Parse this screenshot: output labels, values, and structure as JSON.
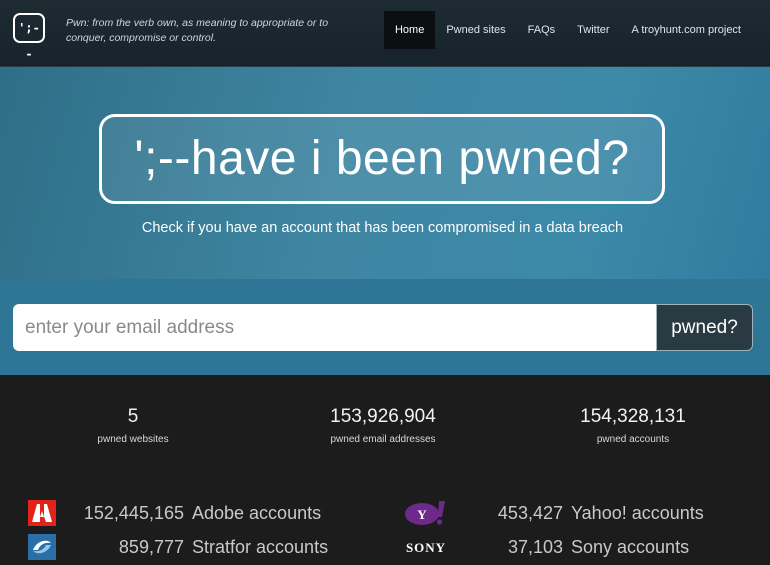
{
  "nav": {
    "logo_text": "';--",
    "tagline": "Pwn: from the verb own, as meaning to appropriate or to conquer, compromise or control.",
    "items": [
      {
        "label": "Home",
        "active": true
      },
      {
        "label": "Pwned sites",
        "active": false
      },
      {
        "label": "FAQs",
        "active": false
      },
      {
        "label": "Twitter",
        "active": false
      },
      {
        "label": "A troyhunt.com project",
        "active": false
      }
    ]
  },
  "hero": {
    "title": "';--have i been pwned?",
    "subtitle": "Check if you have an account that has been compromised in a data breach"
  },
  "search": {
    "placeholder": "enter your email address",
    "value": "",
    "button_label": "pwned?"
  },
  "stats": [
    {
      "value": "5",
      "label": "pwned websites"
    },
    {
      "value": "153,926,904",
      "label": "pwned email addresses"
    },
    {
      "value": "154,328,131",
      "label": "pwned accounts"
    }
  ],
  "breaches": [
    {
      "count": "152,445,165",
      "name": "Adobe accounts",
      "icon": "adobe-logo-icon"
    },
    {
      "count": "859,777",
      "name": "Stratfor accounts",
      "icon": "stratfor-logo-icon"
    },
    {
      "count": "453,427",
      "name": "Yahoo! accounts",
      "icon": "yahoo-logo-icon"
    },
    {
      "count": "37,103",
      "name": "Sony accounts",
      "icon": "sony-logo-icon",
      "logo_text": "SONY"
    }
  ],
  "colors": {
    "navbar": "#1e2b33",
    "hero": "#3f86a2",
    "dark_band": "#1c1c1c",
    "button": "#2a3a43"
  }
}
